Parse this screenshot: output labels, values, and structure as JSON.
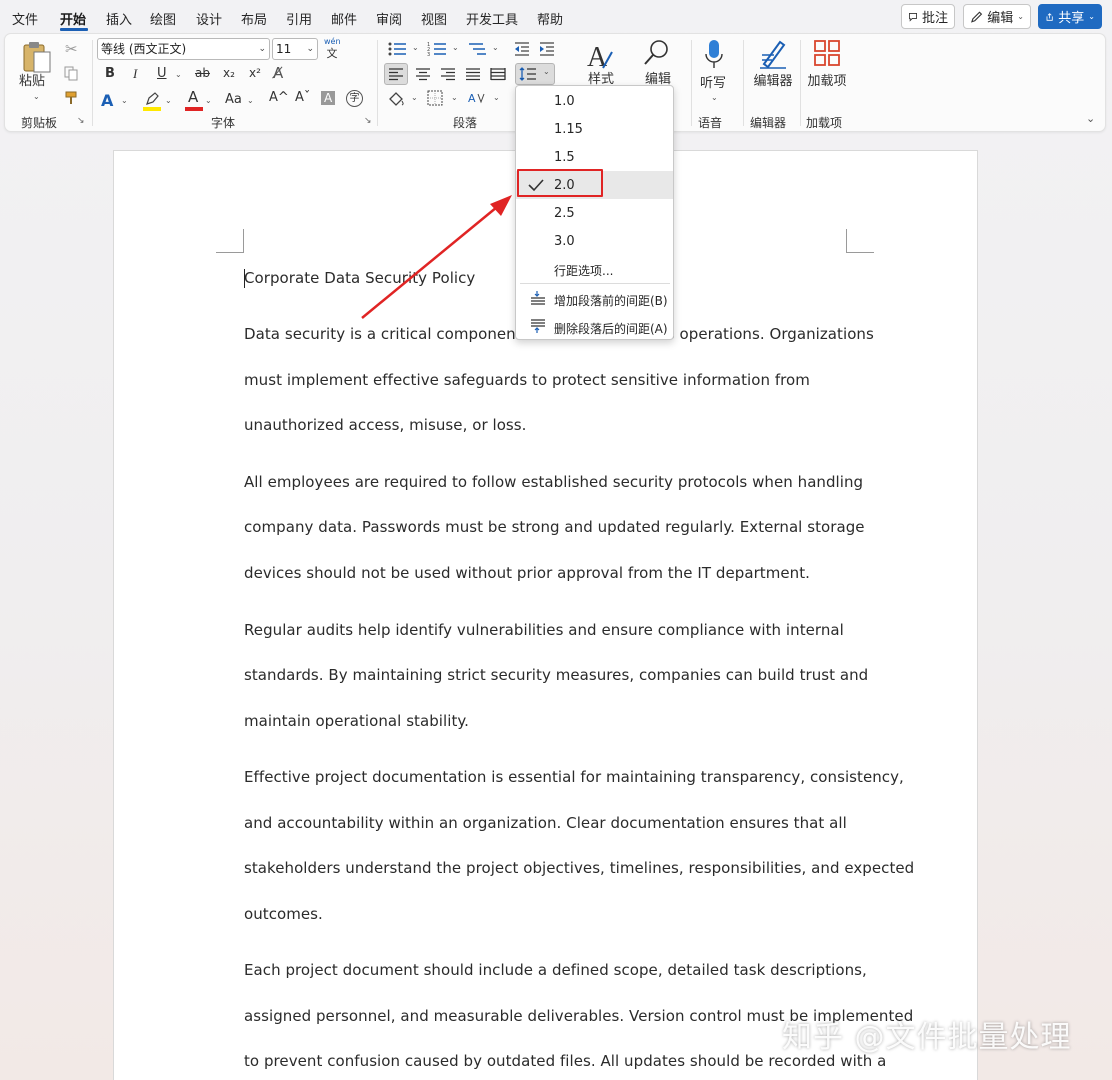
{
  "menu": {
    "tabs": [
      "文件",
      "开始",
      "插入",
      "绘图",
      "设计",
      "布局",
      "引用",
      "邮件",
      "审阅",
      "视图",
      "开发工具",
      "帮助"
    ],
    "active": "开始"
  },
  "topbar": {
    "comment_label": "批注",
    "edit_label": "编辑",
    "share_label": "共享"
  },
  "ribbon": {
    "clipboard": {
      "paste_label": "粘贴",
      "group_label": "剪贴板"
    },
    "font": {
      "font_name": "等线 (西文正文)",
      "font_size": "11",
      "phonetic_top": "wén",
      "phonetic_bottom": "文",
      "bold": "B",
      "italic": "I",
      "underline": "U",
      "strike": "ab",
      "subscript": "x₂",
      "superscript": "x²",
      "change_case": "Aa",
      "grow": "A^",
      "shrink": "Aˇ",
      "char_shade": "A",
      "enclose": "字",
      "group_label": "字体",
      "highlight_color": "#ffe800",
      "font_color": "#e02424"
    },
    "paragraph": {
      "group_label": "段落"
    },
    "styles": {
      "label": "样式"
    },
    "editing": {
      "label": "编辑"
    },
    "voice": {
      "dictate_label": "听写",
      "group_label": "语音"
    },
    "editor": {
      "label": "编辑器",
      "group_label": "编辑器"
    },
    "addins": {
      "label": "加载项",
      "group_label": "加载项"
    }
  },
  "line_spacing_menu": {
    "options": [
      "1.0",
      "1.15",
      "1.5",
      "2.0",
      "2.5",
      "3.0"
    ],
    "selected": "2.0",
    "more_options": "行距选项...",
    "add_space_before": "增加段落前的间距(B)",
    "remove_space_after": "删除段落后的间距(A)"
  },
  "document": {
    "title": "Corporate Data Security Policy",
    "lines": [
      "Data security is a critical component of modern business operations. Organizations",
      "must implement effective safeguards to protect sensitive information from",
      "unauthorized access, misuse, or loss.",
      "All employees are required to follow established security protocols when handling",
      "company data. Passwords must be strong and updated regularly. External storage",
      "devices should not be used without prior approval from the IT department.",
      "Regular audits help identify vulnerabilities and ensure compliance with internal",
      "standards. By maintaining strict security measures, companies can build trust and",
      "maintain operational stability.",
      "Effective project documentation is essential for maintaining transparency, consistency,",
      "and accountability within an organization. Clear documentation ensures that all",
      "stakeholders understand the project objectives, timelines, responsibilities, and expected",
      "outcomes.",
      "Each project document should include a defined scope, detailed task descriptions,",
      "assigned personnel, and measurable deliverables. Version control must be implemented",
      "to prevent confusion caused by outdated files. All updates should be recorded with a"
    ]
  },
  "watermark": "知乎 @文件批量处理",
  "colors": {
    "accent": "#1b5fb4",
    "annotation_red": "#e02424"
  }
}
